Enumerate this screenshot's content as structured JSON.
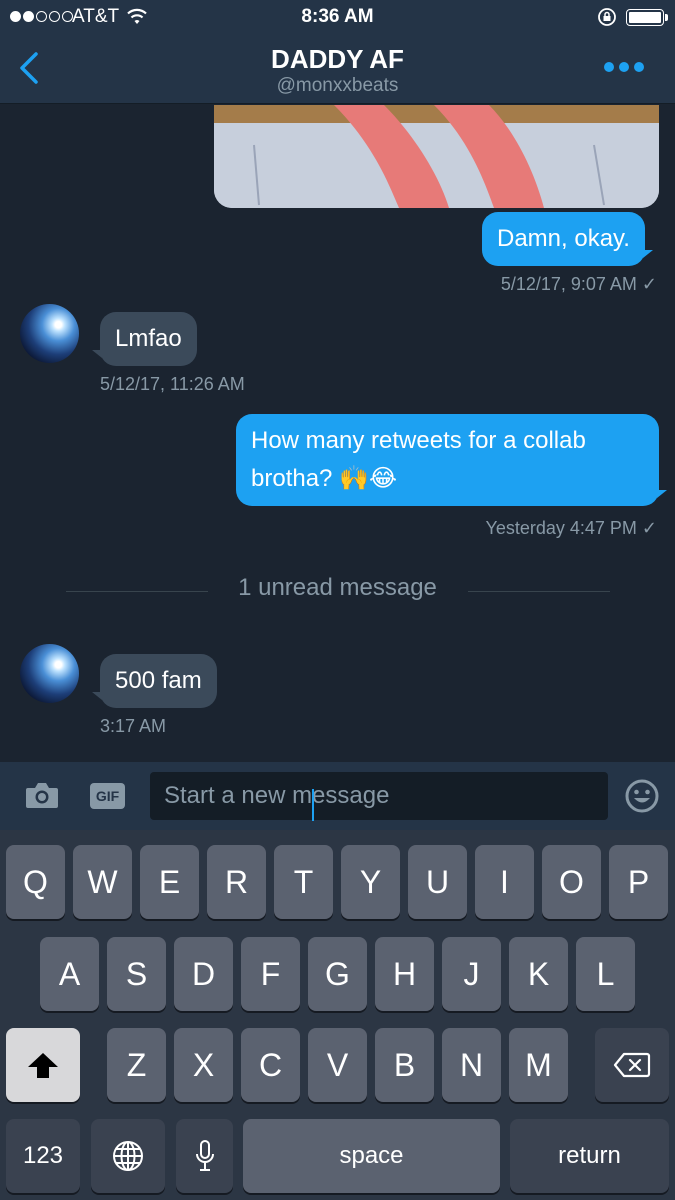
{
  "status_bar": {
    "carrier": "AT&T",
    "time": "8:36 AM",
    "signal_icon": "signal-dots-icon",
    "wifi_icon": "wifi-icon",
    "lock_icon": "rotation-lock-icon",
    "battery_icon": "battery-icon"
  },
  "header": {
    "title": "DADDY AF",
    "handle": "@monxxbeats",
    "back_icon": "chevron-left-icon",
    "more_icon": "more-dots-icon",
    "accent": "#1da1f2"
  },
  "messages": [
    {
      "from": "me",
      "text": "Damn, okay.",
      "timestamp": "5/12/17, 9:07 AM ✓"
    },
    {
      "from": "them",
      "text": "Lmfao",
      "timestamp": "5/12/17, 11:26 AM"
    },
    {
      "from": "me",
      "text_line1": "How many retweets for a collab",
      "text_line2": "brotha? 🙌😂",
      "timestamp": "Yesterday 4:47 PM ✓"
    },
    {
      "from": "them",
      "text": "500 fam",
      "timestamp": "3:17 AM"
    }
  ],
  "unread_divider": "1 unread message",
  "composer": {
    "camera_icon": "camera-icon",
    "gif_label": "GIF",
    "placeholder": "Start a new message",
    "emoji_icon": "smiley-icon"
  },
  "keyboard": {
    "row1": [
      "Q",
      "W",
      "E",
      "R",
      "T",
      "Y",
      "U",
      "I",
      "O",
      "P"
    ],
    "row2": [
      "A",
      "S",
      "D",
      "F",
      "G",
      "H",
      "J",
      "K",
      "L"
    ],
    "row3": [
      "Z",
      "X",
      "C",
      "V",
      "B",
      "N",
      "M"
    ],
    "numbers_label": "123",
    "space_label": "space",
    "return_label": "return",
    "shift_icon": "shift-arrow-icon",
    "delete_icon": "backspace-icon",
    "globe_icon": "globe-icon",
    "mic_icon": "microphone-icon"
  },
  "colors": {
    "background": "#1b2430",
    "bar": "#243447",
    "outgoing_bubble": "#1da1f2",
    "incoming_bubble": "#3b4a5a",
    "muted_text": "#8899a6"
  }
}
